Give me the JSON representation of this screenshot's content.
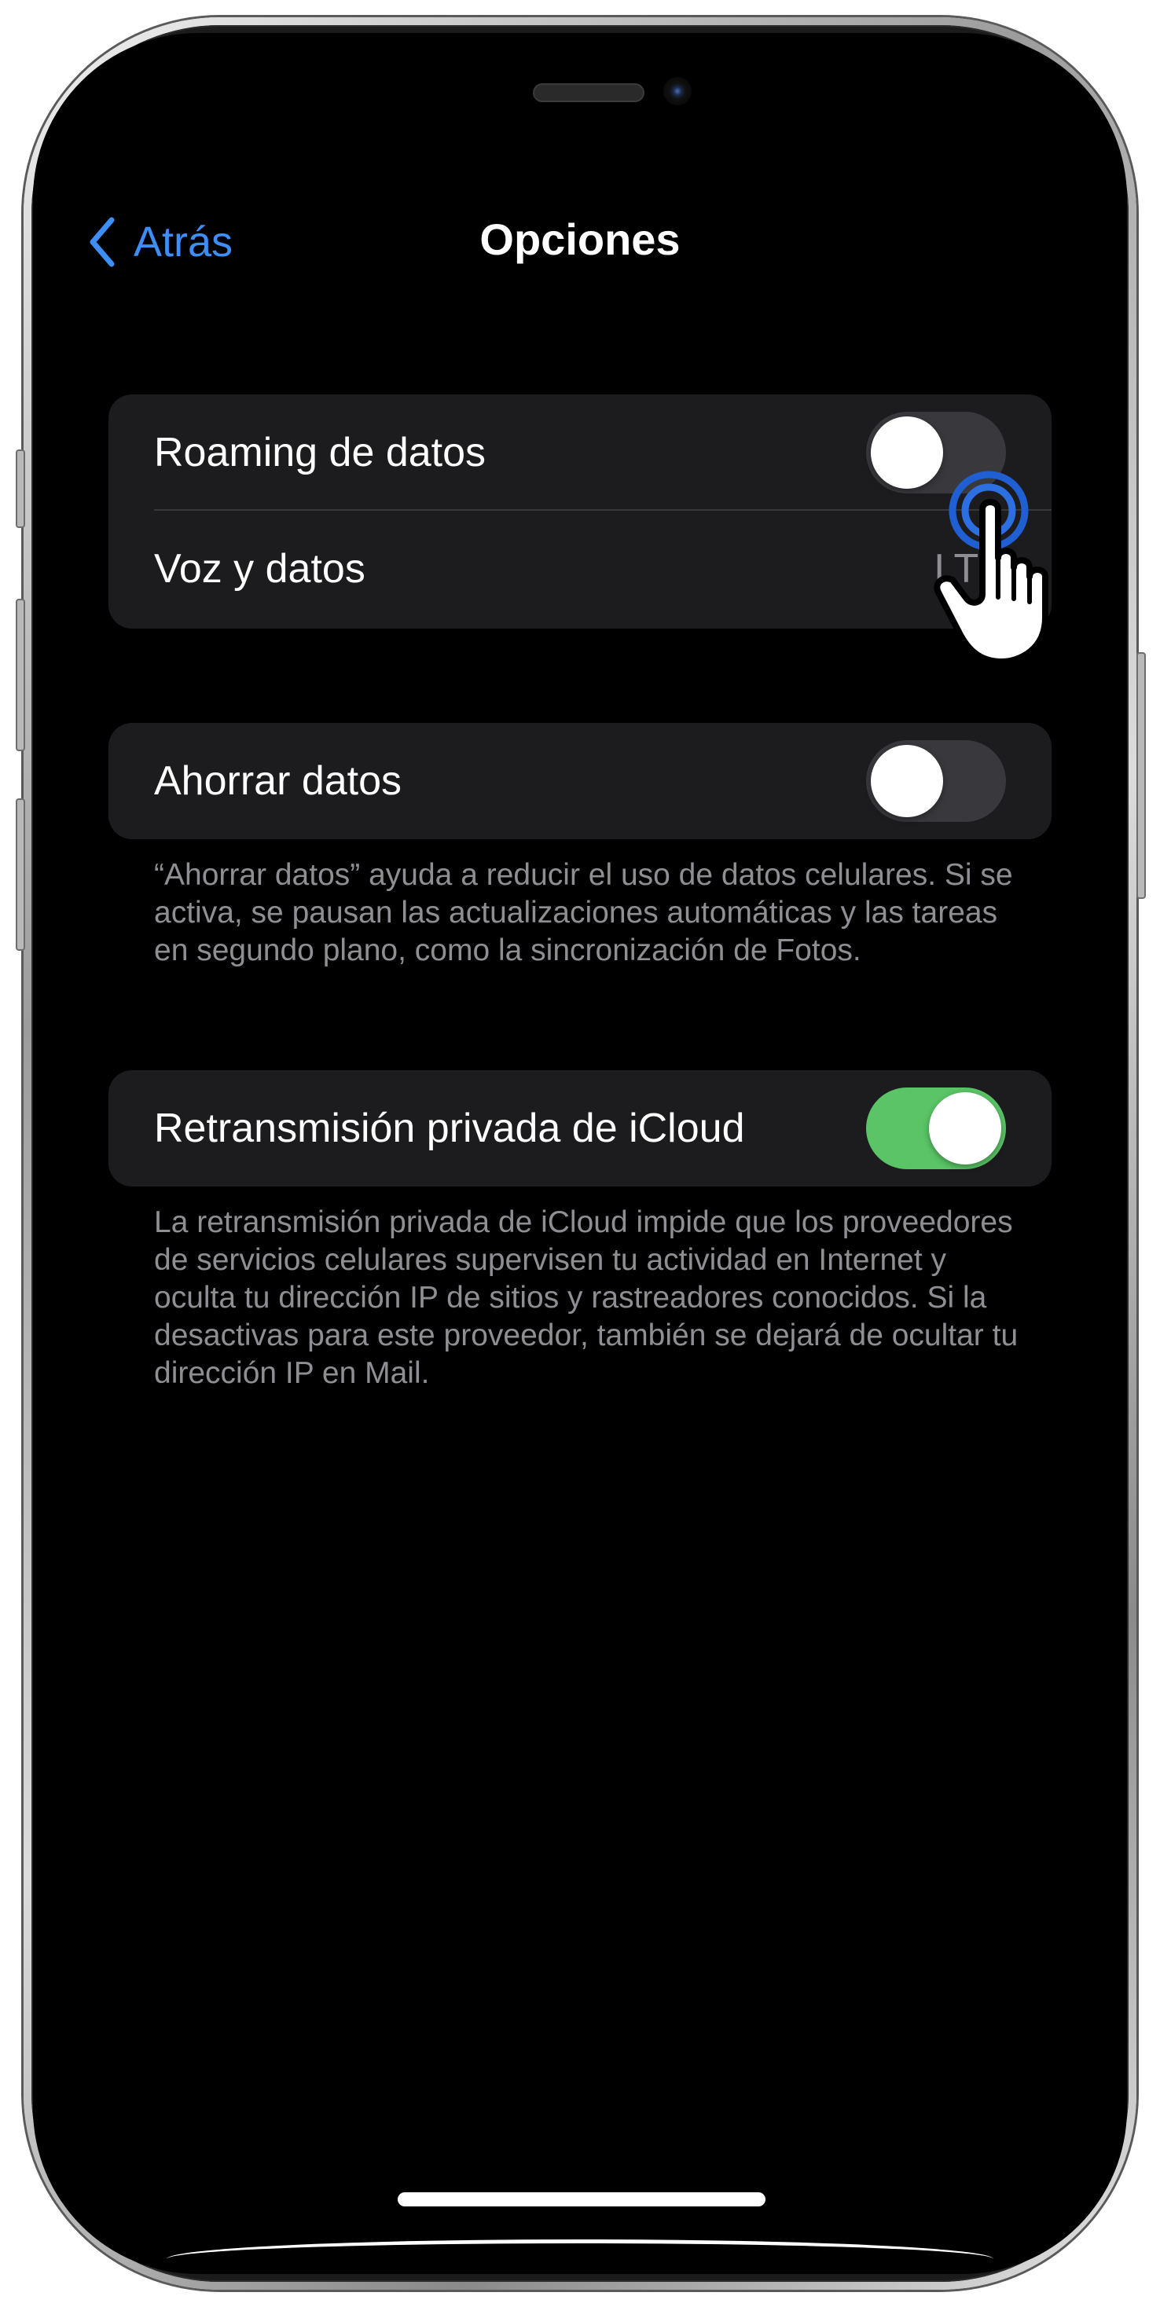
{
  "nav": {
    "back_label": "Atrás",
    "title": "Opciones"
  },
  "group1": {
    "roaming_label": "Roaming de datos",
    "roaming_on": false,
    "voice_label": "Voz y datos",
    "voice_value": "LTE"
  },
  "group2": {
    "low_data_label": "Ahorrar datos",
    "low_data_on": false,
    "footnote": "“Ahorrar datos” ayuda a reducir el uso de datos celulares. Si se activa, se pausan las actualizaciones automáticas y las tareas en segundo plano, como la sincronización de Fotos."
  },
  "group3": {
    "relay_label": "Retransmisión privada de iCloud",
    "relay_on": true,
    "footnote": "La retransmisión privada de iCloud impide que los proveedores de servicios celulares supervisen tu actividad en Internet y oculta tu dirección IP de sitios y rastreadores conocidos. Si la desactivas para este proveedor, también se dejará de ocultar tu dirección IP en Mail."
  },
  "colors": {
    "accent": "#3e8ef7",
    "toggle_on": "#5ac466",
    "toggle_off": "#39393d",
    "cell_bg": "#1c1c1e"
  },
  "icons": {
    "back": "chevron-left-icon",
    "cursor": "tap-hand-icon"
  }
}
